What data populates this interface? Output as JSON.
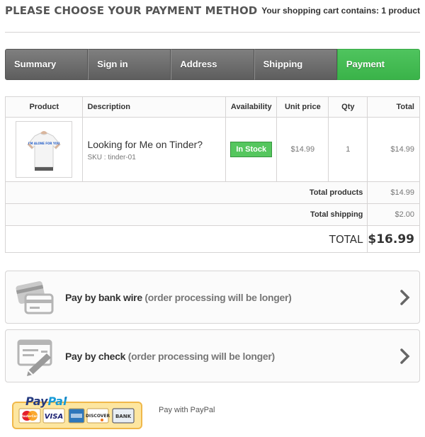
{
  "header": {
    "title": "PLEASE CHOOSE YOUR PAYMENT METHOD",
    "cart_summary": "Your shopping cart contains: 1 product"
  },
  "steps": [
    {
      "label": "Summary",
      "active": false
    },
    {
      "label": "Sign in",
      "active": false
    },
    {
      "label": "Address",
      "active": false
    },
    {
      "label": "Shipping",
      "active": false
    },
    {
      "label": "Payment",
      "active": true
    }
  ],
  "cart_table": {
    "columns": [
      "Product",
      "Description",
      "Availability",
      "Unit price",
      "Qty",
      "Total"
    ],
    "items": [
      {
        "name": "Looking for Me on Tinder?",
        "sku": "SKU : tinder-01",
        "availability": "In Stock",
        "unit_price": "$14.99",
        "qty": "1",
        "total": "$14.99",
        "shirt_print": "I'M ALONE FOR YOU"
      }
    ],
    "total_products_label": "Total products",
    "total_products_value": "$14.99",
    "total_shipping_label": "Total shipping",
    "total_shipping_value": "$2.00",
    "grand_total_label": "TOTAL",
    "grand_total_value": "$16.99"
  },
  "payment_options": [
    {
      "title": "Pay by bank wire",
      "note": "(order processing will be longer)",
      "icon": "bank-card-icon"
    },
    {
      "title": "Pay by check",
      "note": "(order processing will be longer)",
      "icon": "check-pen-icon"
    }
  ],
  "paypal": {
    "logo_text": "PayPal",
    "cards": [
      "MasterCard",
      "VISA",
      "AMEX",
      "DISCOVER",
      "BANK"
    ],
    "label": "Pay with PayPal"
  },
  "colors": {
    "step_active": "#46bd55",
    "step_inactive": "#6f6f6f",
    "in_stock": "#55c65e",
    "paypal_blue": "#253b80",
    "paypal_light_blue": "#179bd7"
  }
}
